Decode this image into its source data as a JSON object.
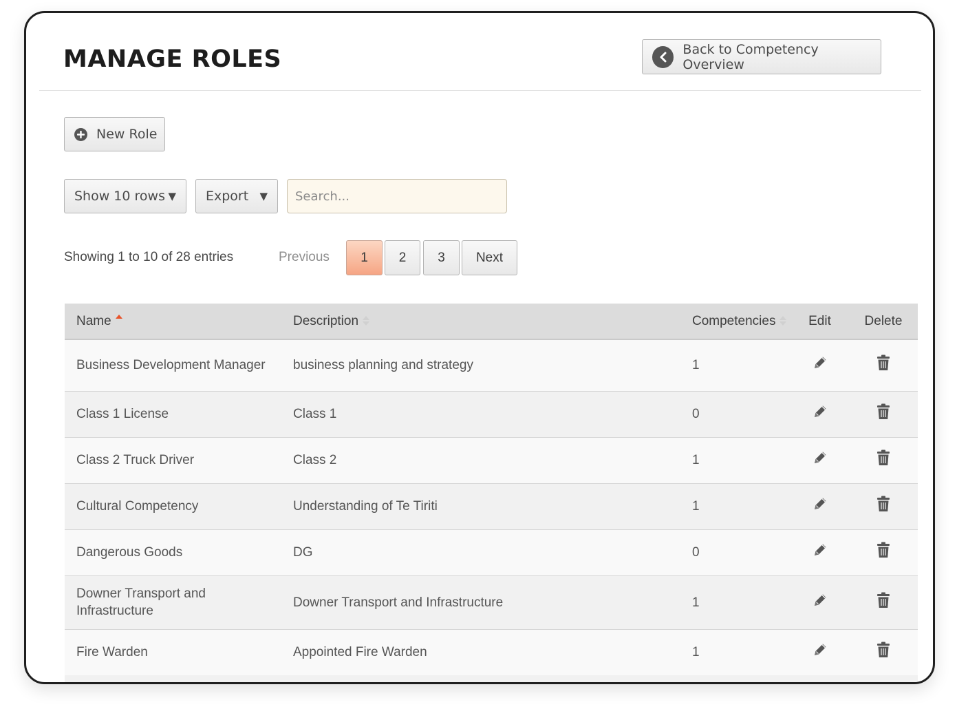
{
  "header": {
    "title": "MANAGE ROLES",
    "back_label": "Back to Competency Overview"
  },
  "toolbar": {
    "new_role_label": "New Role",
    "rows_label": "Show 10 rows",
    "export_label": "Export",
    "search_placeholder": "Search..."
  },
  "pagination": {
    "info": "Showing 1 to 10 of 28 entries",
    "previous": "Previous",
    "pages": [
      "1",
      "2",
      "3"
    ],
    "next": "Next",
    "current_page": 1
  },
  "table": {
    "columns": {
      "name": "Name",
      "description": "Description",
      "competencies": "Competencies",
      "edit": "Edit",
      "delete": "Delete"
    },
    "sort_column": "Name",
    "sort_direction": "ascending",
    "rows": [
      {
        "name": "Business Development Manager",
        "description": "business planning and strategy",
        "competencies": "1"
      },
      {
        "name": "Class 1 License",
        "description": "Class 1",
        "competencies": "0"
      },
      {
        "name": "Class 2 Truck Driver",
        "description": "Class 2",
        "competencies": "1"
      },
      {
        "name": "Cultural Competency",
        "description": "Understanding of Te Tiriti",
        "competencies": "1"
      },
      {
        "name": "Dangerous Goods",
        "description": "DG",
        "competencies": "0"
      },
      {
        "name": "Downer Transport and Infrastructure",
        "description": "Downer Transport and Infrastructure",
        "competencies": "1"
      },
      {
        "name": "Fire Warden",
        "description": "Appointed Fire Warden",
        "competencies": "1"
      }
    ]
  },
  "colors": {
    "active_page": "#f6a584",
    "sort_active": "#e8532a",
    "search_bg": "#fdf8ed"
  },
  "icons": {
    "back": "chevron-left-icon",
    "new": "plus-circle-icon",
    "edit": "pencil-icon",
    "delete": "trash-icon"
  }
}
